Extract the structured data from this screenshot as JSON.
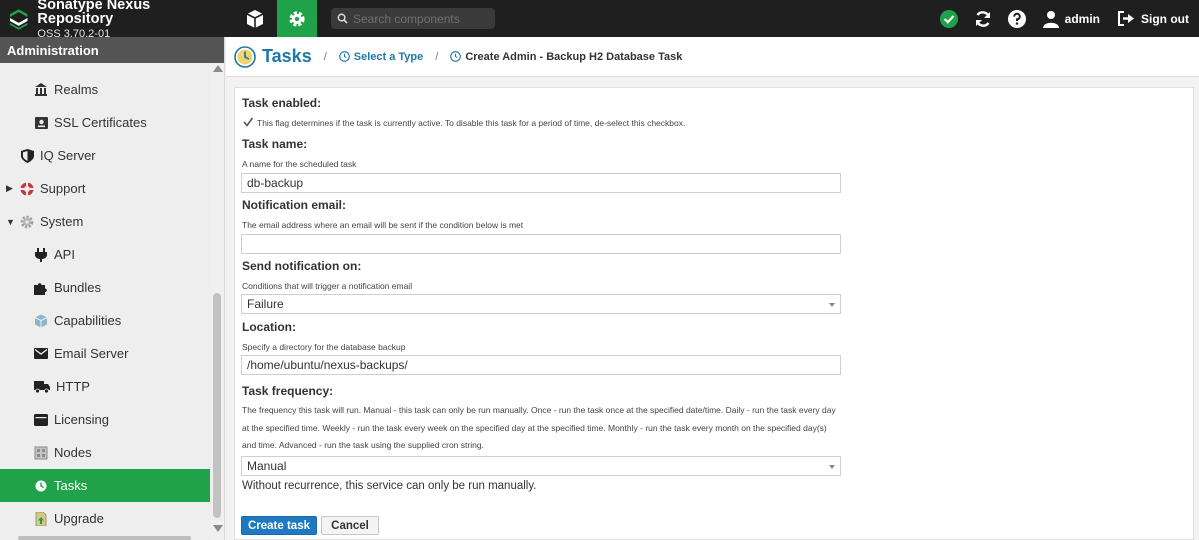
{
  "app": {
    "title": "Sonatype Nexus Repository",
    "version": "OSS 3.70.2-01"
  },
  "topbar": {
    "search_placeholder": "Search components",
    "user_label": "admin",
    "signout_label": "Sign out",
    "accent_color": "#1fa24a"
  },
  "sidebar": {
    "header": "Administration",
    "items": [
      {
        "label": "Realms",
        "icon": "realms-icon"
      },
      {
        "label": "SSL Certificates",
        "icon": "certificate-icon"
      },
      {
        "label": "IQ Server",
        "icon": "shield-icon"
      },
      {
        "label": "Support",
        "icon": "support-icon"
      },
      {
        "label": "System",
        "icon": "gear-icon"
      },
      {
        "label": "API",
        "icon": "plug-icon"
      },
      {
        "label": "Bundles",
        "icon": "puzzle-icon"
      },
      {
        "label": "Capabilities",
        "icon": "cube-icon"
      },
      {
        "label": "Email Server",
        "icon": "envelope-icon"
      },
      {
        "label": "HTTP",
        "icon": "truck-icon"
      },
      {
        "label": "Licensing",
        "icon": "wallet-icon"
      },
      {
        "label": "Nodes",
        "icon": "server-icon"
      },
      {
        "label": "Tasks",
        "icon": "clock-icon",
        "selected": true
      },
      {
        "label": "Upgrade",
        "icon": "upgrade-icon"
      }
    ]
  },
  "breadcrumb": {
    "title": "Tasks",
    "sep": "/",
    "link": "Select a Type",
    "current": "Create Admin - Backup H2 Database Task"
  },
  "form": {
    "enabled_label": "Task enabled:",
    "enabled_help": "This flag determines if the task is currently active. To disable this task for a period of time, de-select this checkbox.",
    "enabled_checked": true,
    "name_label": "Task name:",
    "name_help": "A name for the scheduled task",
    "name_value": "db-backup",
    "email_label": "Notification email:",
    "email_help": "The email address where an email will be sent if the condition below is met",
    "email_value": "",
    "notify_label": "Send notification on:",
    "notify_help": "Conditions that will trigger a notification email",
    "notify_value": "Failure",
    "location_label": "Location:",
    "location_help": "Specify a directory for the database backup",
    "location_value": "/home/ubuntu/nexus-backups/",
    "frequency_label": "Task frequency:",
    "frequency_help": "The frequency this task will run. Manual - this task can only be run manually. Once - run the task once at the specified date/time. Daily - run the task every day at the specified time. Weekly - run the task every week on the specified day at the specified time. Monthly - run the task every month on the specified day(s) and time. Advanced - run the task using the supplied cron string.",
    "frequency_value": "Manual",
    "frequency_note": "Without recurrence, this service can only be run manually.",
    "create_label": "Create task",
    "cancel_label": "Cancel"
  }
}
